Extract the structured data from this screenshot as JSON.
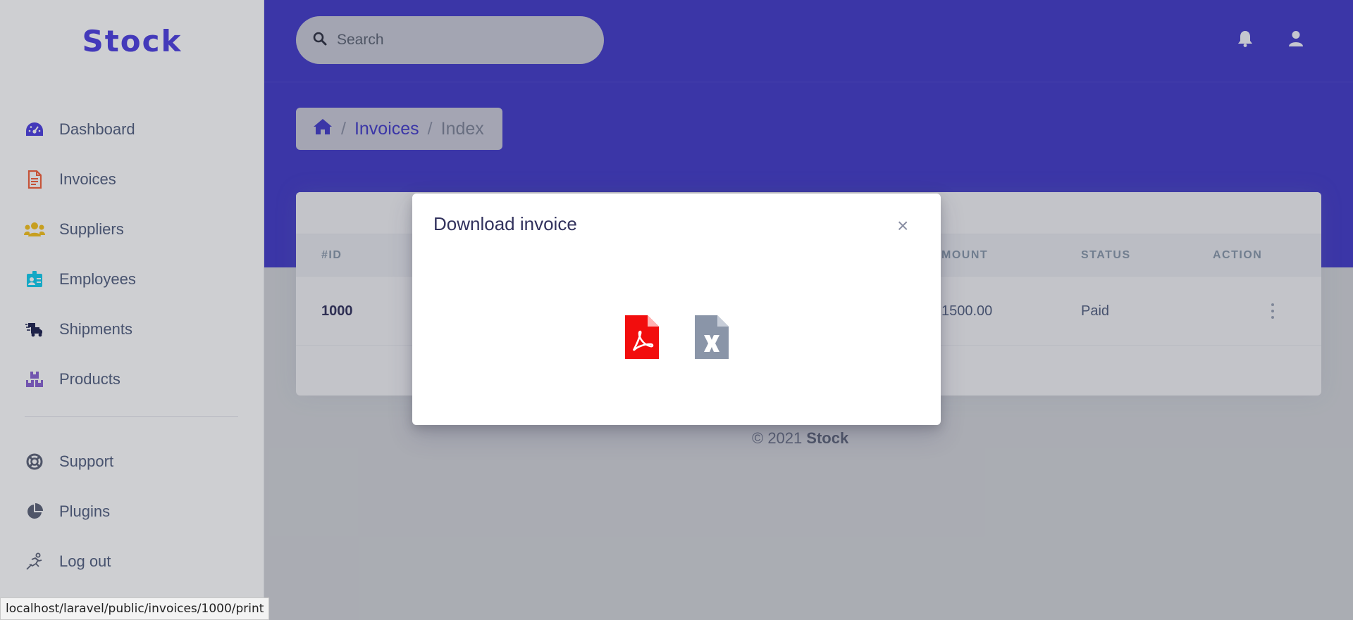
{
  "brand": {
    "name": "Stock",
    "color": "#4e3fe0"
  },
  "sidebar": {
    "items": [
      {
        "label": "Dashboard",
        "icon": "dashboard-icon",
        "color": "#4e3fe0"
      },
      {
        "label": "Invoices",
        "icon": "invoice-icon",
        "color": "#f5603a"
      },
      {
        "label": "Suppliers",
        "icon": "users-icon",
        "color": "#f7c21b"
      },
      {
        "label": "Employees",
        "icon": "id-card-icon",
        "color": "#11cdef"
      },
      {
        "label": "Shipments",
        "icon": "truck-icon",
        "color": "#1f2350"
      },
      {
        "label": "Products",
        "icon": "boxes-icon",
        "color": "#8a63d2"
      }
    ],
    "secondary": [
      {
        "label": "Support",
        "icon": "lifebuoy-icon"
      },
      {
        "label": "Plugins",
        "icon": "pie-chart-icon"
      },
      {
        "label": "Log out",
        "icon": "logout-icon"
      }
    ]
  },
  "header": {
    "search_placeholder": "Search",
    "bg_color": "#433bc8"
  },
  "breadcrumb": {
    "home_icon": "home-icon",
    "sep": "/",
    "link": "Invoices",
    "current": "Index"
  },
  "table": {
    "columns": [
      "#ID",
      "MOUNT",
      "STATUS",
      "ACTION"
    ],
    "rows": [
      {
        "id": "1000",
        "amount": "1500.00",
        "status": "Paid"
      }
    ]
  },
  "footer": {
    "copyright": "© 2021",
    "brand": "Stock"
  },
  "modal": {
    "title": "Download invoice",
    "close": "×",
    "pdf_icon": "pdf-file-icon",
    "excel_icon": "excel-file-icon",
    "pdf_color": "#f20d0d",
    "excel_color": "#8a95a8"
  },
  "statusbar": {
    "url": "localhost/laravel/public/invoices/1000/print"
  }
}
